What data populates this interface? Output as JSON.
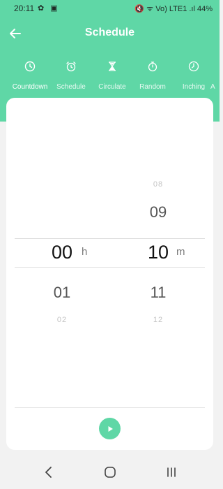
{
  "status_bar": {
    "time": "20:11",
    "left_icons": "✿ ▣",
    "right_text": "🔇 ᯤ Vo) LTE1 .ıl 44%",
    "battery_icon": "battery-icon"
  },
  "header": {
    "title": "Schedule",
    "back_icon": "arrow-left-icon"
  },
  "tabs": [
    {
      "label": "Countdown",
      "icon": "clock-icon",
      "active": true
    },
    {
      "label": "Schedule",
      "icon": "alarm-clock-icon",
      "active": false
    },
    {
      "label": "Circulate",
      "icon": "hourglass-icon",
      "active": false
    },
    {
      "label": "Random",
      "icon": "stopwatch-icon",
      "active": false
    },
    {
      "label": "Inching",
      "icon": "clock-arc-icon",
      "active": false
    },
    {
      "label": "A",
      "icon": "",
      "active": false
    }
  ],
  "picker": {
    "hours": {
      "items": [
        "00",
        "01",
        "02"
      ],
      "selected": "00",
      "unit": "h"
    },
    "minutes": {
      "items": [
        "08",
        "09",
        "10",
        "11",
        "12"
      ],
      "selected": "10",
      "unit": "m"
    }
  },
  "actions": {
    "play_icon": "play-icon"
  },
  "nav_bar": {
    "back_icon": "nav-back-icon",
    "home_icon": "nav-home-icon",
    "recents_icon": "nav-recents-icon"
  },
  "colors": {
    "accent": "#5fd7a6",
    "card_bg": "#ffffff",
    "page_bg": "#f2f2f2"
  }
}
